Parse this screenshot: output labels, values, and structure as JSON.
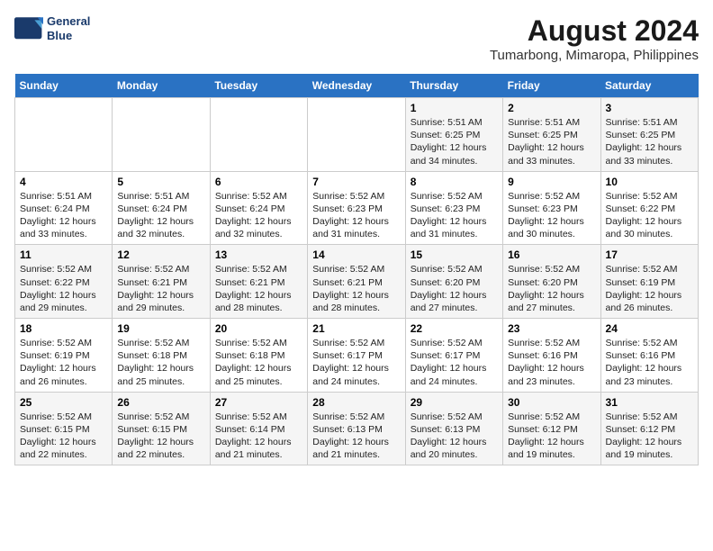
{
  "logo": {
    "line1": "General",
    "line2": "Blue"
  },
  "title": "August 2024",
  "subtitle": "Tumarbong, Mimaropa, Philippines",
  "days_of_week": [
    "Sunday",
    "Monday",
    "Tuesday",
    "Wednesday",
    "Thursday",
    "Friday",
    "Saturday"
  ],
  "weeks": [
    [
      {
        "day": "",
        "info": ""
      },
      {
        "day": "",
        "info": ""
      },
      {
        "day": "",
        "info": ""
      },
      {
        "day": "",
        "info": ""
      },
      {
        "day": "1",
        "info": "Sunrise: 5:51 AM\nSunset: 6:25 PM\nDaylight: 12 hours\nand 34 minutes."
      },
      {
        "day": "2",
        "info": "Sunrise: 5:51 AM\nSunset: 6:25 PM\nDaylight: 12 hours\nand 33 minutes."
      },
      {
        "day": "3",
        "info": "Sunrise: 5:51 AM\nSunset: 6:25 PM\nDaylight: 12 hours\nand 33 minutes."
      }
    ],
    [
      {
        "day": "4",
        "info": "Sunrise: 5:51 AM\nSunset: 6:24 PM\nDaylight: 12 hours\nand 33 minutes."
      },
      {
        "day": "5",
        "info": "Sunrise: 5:51 AM\nSunset: 6:24 PM\nDaylight: 12 hours\nand 32 minutes."
      },
      {
        "day": "6",
        "info": "Sunrise: 5:52 AM\nSunset: 6:24 PM\nDaylight: 12 hours\nand 32 minutes."
      },
      {
        "day": "7",
        "info": "Sunrise: 5:52 AM\nSunset: 6:23 PM\nDaylight: 12 hours\nand 31 minutes."
      },
      {
        "day": "8",
        "info": "Sunrise: 5:52 AM\nSunset: 6:23 PM\nDaylight: 12 hours\nand 31 minutes."
      },
      {
        "day": "9",
        "info": "Sunrise: 5:52 AM\nSunset: 6:23 PM\nDaylight: 12 hours\nand 30 minutes."
      },
      {
        "day": "10",
        "info": "Sunrise: 5:52 AM\nSunset: 6:22 PM\nDaylight: 12 hours\nand 30 minutes."
      }
    ],
    [
      {
        "day": "11",
        "info": "Sunrise: 5:52 AM\nSunset: 6:22 PM\nDaylight: 12 hours\nand 29 minutes."
      },
      {
        "day": "12",
        "info": "Sunrise: 5:52 AM\nSunset: 6:21 PM\nDaylight: 12 hours\nand 29 minutes."
      },
      {
        "day": "13",
        "info": "Sunrise: 5:52 AM\nSunset: 6:21 PM\nDaylight: 12 hours\nand 28 minutes."
      },
      {
        "day": "14",
        "info": "Sunrise: 5:52 AM\nSunset: 6:21 PM\nDaylight: 12 hours\nand 28 minutes."
      },
      {
        "day": "15",
        "info": "Sunrise: 5:52 AM\nSunset: 6:20 PM\nDaylight: 12 hours\nand 27 minutes."
      },
      {
        "day": "16",
        "info": "Sunrise: 5:52 AM\nSunset: 6:20 PM\nDaylight: 12 hours\nand 27 minutes."
      },
      {
        "day": "17",
        "info": "Sunrise: 5:52 AM\nSunset: 6:19 PM\nDaylight: 12 hours\nand 26 minutes."
      }
    ],
    [
      {
        "day": "18",
        "info": "Sunrise: 5:52 AM\nSunset: 6:19 PM\nDaylight: 12 hours\nand 26 minutes."
      },
      {
        "day": "19",
        "info": "Sunrise: 5:52 AM\nSunset: 6:18 PM\nDaylight: 12 hours\nand 25 minutes."
      },
      {
        "day": "20",
        "info": "Sunrise: 5:52 AM\nSunset: 6:18 PM\nDaylight: 12 hours\nand 25 minutes."
      },
      {
        "day": "21",
        "info": "Sunrise: 5:52 AM\nSunset: 6:17 PM\nDaylight: 12 hours\nand 24 minutes."
      },
      {
        "day": "22",
        "info": "Sunrise: 5:52 AM\nSunset: 6:17 PM\nDaylight: 12 hours\nand 24 minutes."
      },
      {
        "day": "23",
        "info": "Sunrise: 5:52 AM\nSunset: 6:16 PM\nDaylight: 12 hours\nand 23 minutes."
      },
      {
        "day": "24",
        "info": "Sunrise: 5:52 AM\nSunset: 6:16 PM\nDaylight: 12 hours\nand 23 minutes."
      }
    ],
    [
      {
        "day": "25",
        "info": "Sunrise: 5:52 AM\nSunset: 6:15 PM\nDaylight: 12 hours\nand 22 minutes."
      },
      {
        "day": "26",
        "info": "Sunrise: 5:52 AM\nSunset: 6:15 PM\nDaylight: 12 hours\nand 22 minutes."
      },
      {
        "day": "27",
        "info": "Sunrise: 5:52 AM\nSunset: 6:14 PM\nDaylight: 12 hours\nand 21 minutes."
      },
      {
        "day": "28",
        "info": "Sunrise: 5:52 AM\nSunset: 6:13 PM\nDaylight: 12 hours\nand 21 minutes."
      },
      {
        "day": "29",
        "info": "Sunrise: 5:52 AM\nSunset: 6:13 PM\nDaylight: 12 hours\nand 20 minutes."
      },
      {
        "day": "30",
        "info": "Sunrise: 5:52 AM\nSunset: 6:12 PM\nDaylight: 12 hours\nand 19 minutes."
      },
      {
        "day": "31",
        "info": "Sunrise: 5:52 AM\nSunset: 6:12 PM\nDaylight: 12 hours\nand 19 minutes."
      }
    ]
  ]
}
